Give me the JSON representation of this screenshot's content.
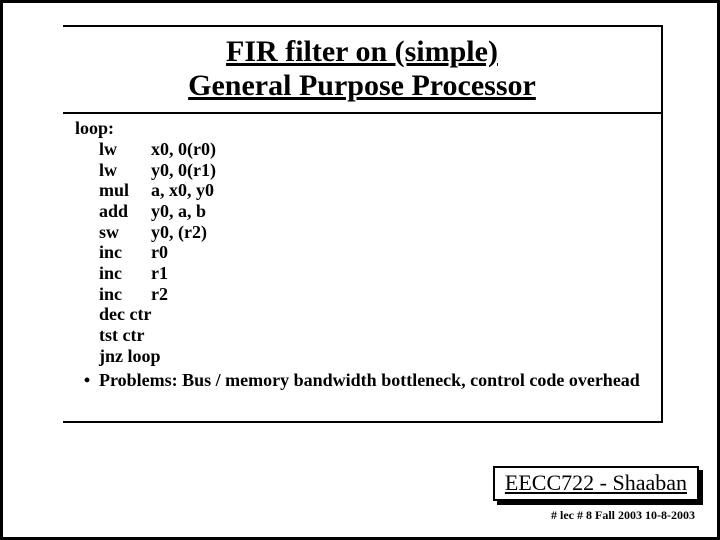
{
  "title_line1": "FIR filter on (simple)",
  "title_line2": "General Purpose Processor",
  "code": {
    "label": "loop:",
    "lines": [
      {
        "mnemonic": "lw",
        "args": "x0, 0(r0)"
      },
      {
        "mnemonic": "lw",
        "args": "y0, 0(r1)"
      },
      {
        "mnemonic": "mul",
        "args": "a, x0, y0"
      },
      {
        "mnemonic": "add",
        "args": "y0, a, b"
      },
      {
        "mnemonic": "sw",
        "args": "y0, (r2)"
      },
      {
        "mnemonic": "inc",
        "args": "r0"
      },
      {
        "mnemonic": "inc",
        "args": "r1"
      },
      {
        "mnemonic": "inc",
        "args": "r2"
      },
      {
        "mnemonic": "dec ctr",
        "args": ""
      },
      {
        "mnemonic": "tst ctr",
        "args": ""
      },
      {
        "mnemonic": "jnz loop",
        "args": ""
      }
    ]
  },
  "bullet": "Problems: Bus / memory bandwidth bottleneck, control code overhead",
  "footer": "EECC722 - Shaaban",
  "subfooter": "#  lec # 8    Fall 2003   10-8-2003"
}
